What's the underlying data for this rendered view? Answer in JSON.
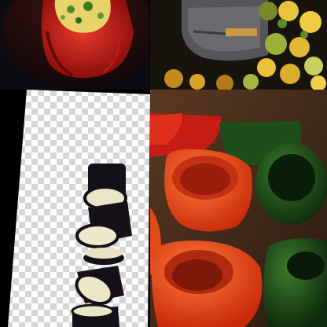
{
  "collage": {
    "tiles": [
      {
        "subject": "stuffed-red-pepper"
      },
      {
        "subject": "roasted-vegetables-in-pan"
      },
      {
        "subject": "sliced-eggplant"
      },
      {
        "subject": "hollowed-bell-peppers"
      }
    ]
  },
  "colors": {
    "red_pepper": "#d8281a",
    "orange_pepper": "#f04a18",
    "green_pepper": "#1f5a1c",
    "eggplant_skin": "#141018",
    "eggplant_flesh": "#e9e6c8",
    "filling_yellow": "#e8d36a"
  }
}
